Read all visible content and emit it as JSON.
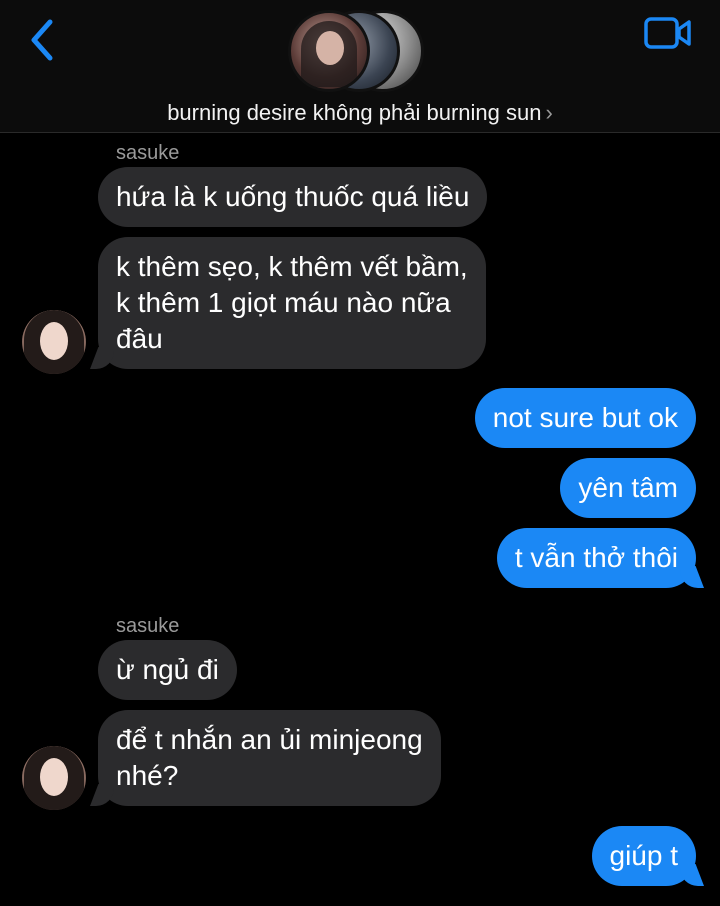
{
  "header": {
    "group_name": "burning desire không phải burning sun",
    "chevron": "›"
  },
  "messages": [
    {
      "sender": "sasuke"
    },
    {
      "text": "hứa là k uống thuốc quá liều"
    },
    {
      "text": "k thêm sẹo, k thêm vết bầm,\nk thêm 1 giọt máu nào nữa\nđâu"
    },
    {
      "text": "not sure but ok"
    },
    {
      "text": "yên tâm"
    },
    {
      "text": "t vẫn thở thôi"
    },
    {
      "sender": "sasuke"
    },
    {
      "text": "ừ ngủ đi"
    },
    {
      "text": "để t nhắn an ủi minjeong\nnhé?"
    },
    {
      "text": "giúp t"
    }
  ],
  "colors": {
    "accent": "#1b88f5",
    "incoming_bubble": "#2b2b2d",
    "background": "#000000"
  },
  "icons": {
    "back": "chevron-left-icon",
    "video": "video-camera-icon"
  }
}
